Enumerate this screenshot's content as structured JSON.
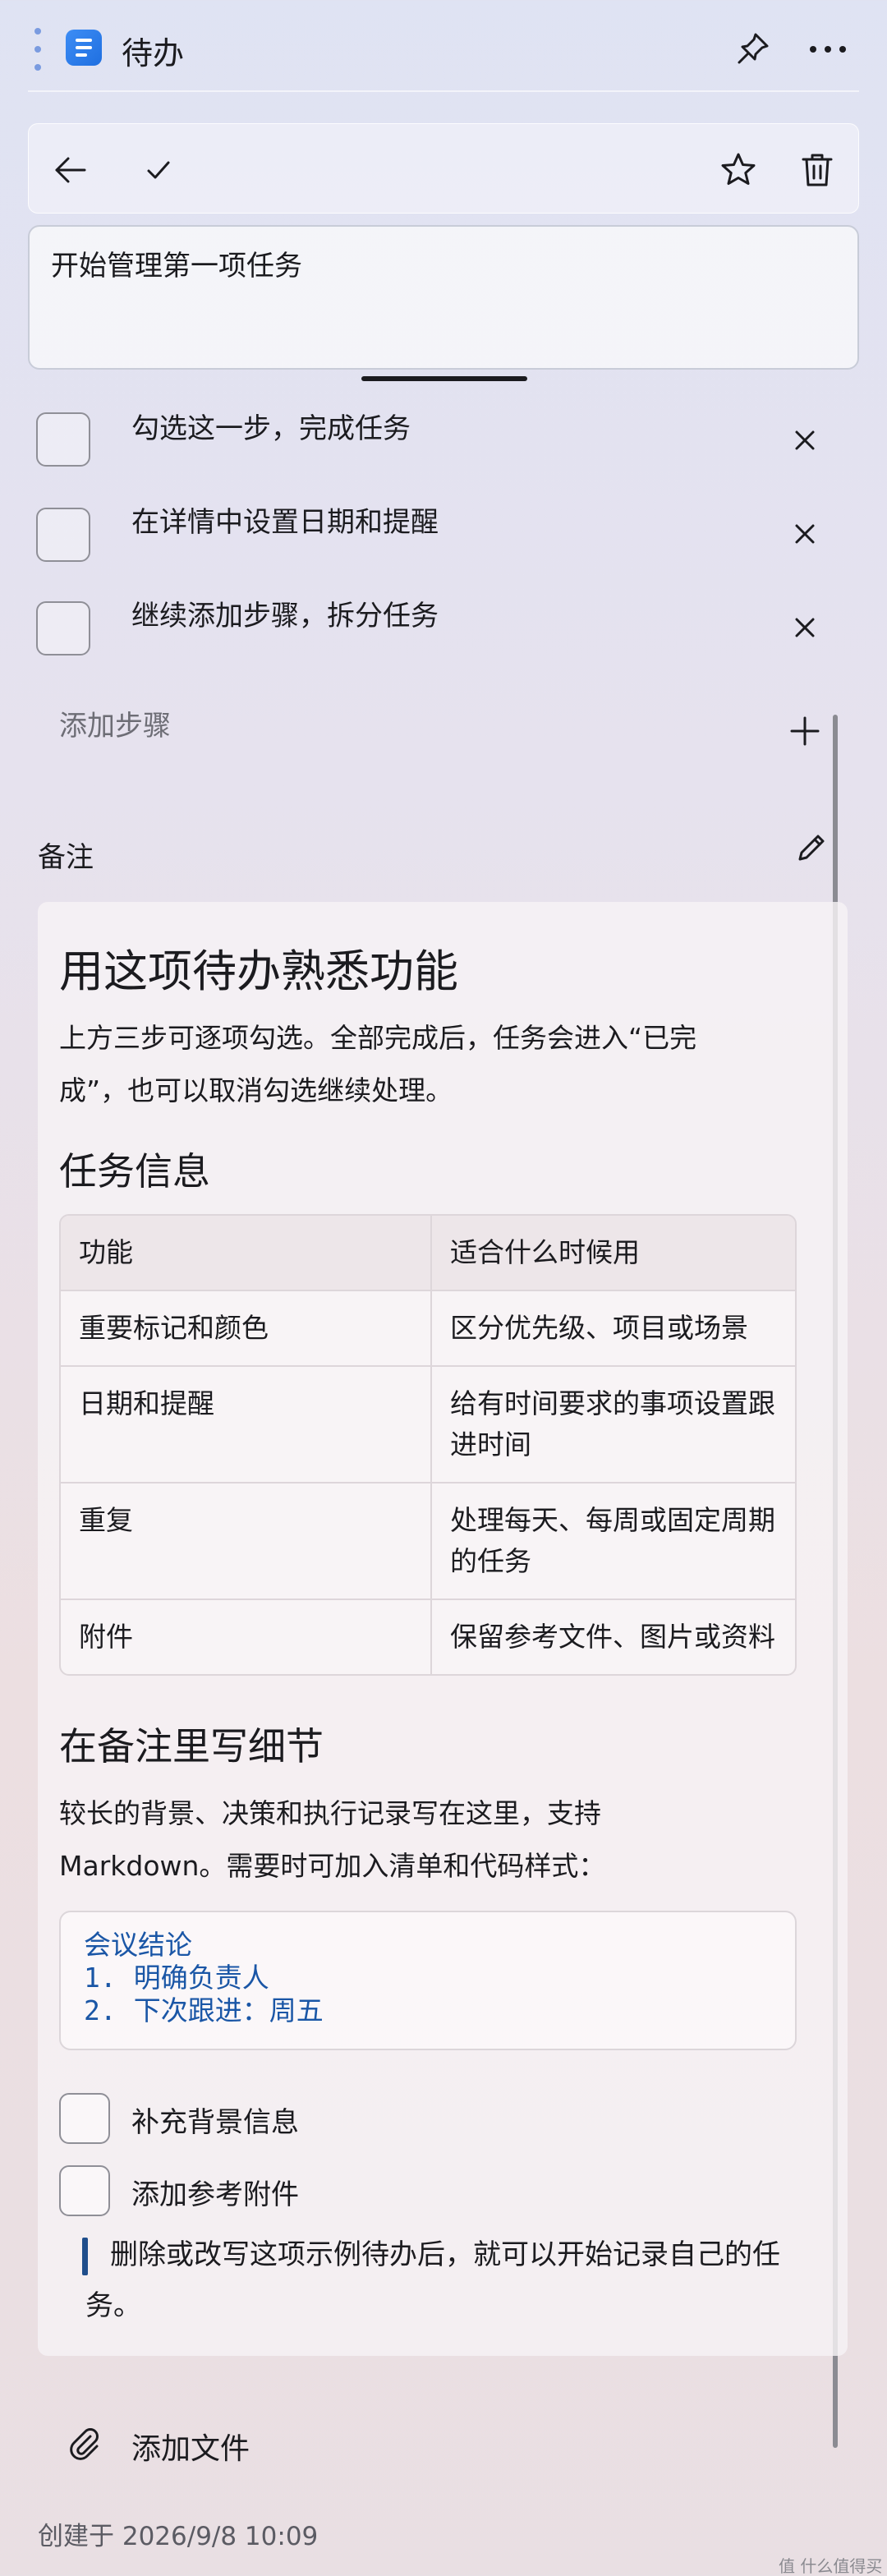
{
  "app": {
    "title": "待办"
  },
  "task": {
    "title": "开始管理第一项任务"
  },
  "steps": [
    {
      "label": "勾选这一步，完成任务"
    },
    {
      "label": "在详情中设置日期和提醒"
    },
    {
      "label": "继续添加步骤，拆分任务"
    }
  ],
  "add_step": {
    "label": "添加步骤"
  },
  "notes": {
    "section_label": "备注",
    "heading": "用这项待办熟悉功能",
    "intro_line1": "上方三步可逐项勾选。全部完成后，任务会进入“已完",
    "intro_line2": "成”，也可以取消勾选继续处理。",
    "subheading1": "任务信息",
    "table": {
      "headers": [
        "功能",
        "适合什么时候用"
      ],
      "rows": [
        [
          "重要标记和颜色",
          "区分优先级、项目或场景"
        ],
        [
          "日期和提醒",
          "给有时间要求的事项设置跟进时间"
        ],
        [
          "重复",
          "处理每天、每周或固定周期的任务"
        ],
        [
          "附件",
          "保留参考文件、图片或资料"
        ]
      ]
    },
    "subheading2": "在备注里写细节",
    "detail_line1": "较长的背景、决策和执行记录写在这里，支持",
    "detail_line2": "Markdown。需要时可加入清单和代码样式：",
    "code": {
      "line1": "会议结论",
      "line2_num": "1.",
      "line2_text": "明确负责人",
      "line3_num": "2.",
      "line3_text": "下次跟进：周五"
    },
    "checklist": [
      {
        "label": "补充背景信息"
      },
      {
        "label": "添加参考附件"
      }
    ],
    "quote": "删除或改写这项示例待办后，就可以开始记录自己的任务。"
  },
  "attach": {
    "label": "添加文件"
  },
  "created": "创建于 2026/9/8 10:09",
  "watermark": "值 什么值得买",
  "icons": {
    "grip": "vertical-dots-icon",
    "app": "todo-list-icon",
    "pin": "pin-icon",
    "more": "more-horizontal-icon",
    "back": "arrow-left-icon",
    "complete": "checkmark-icon",
    "star": "star-icon",
    "delete": "trash-icon",
    "remove": "close-icon",
    "add": "plus-icon",
    "edit": "pencil-icon",
    "attach": "paperclip-icon"
  },
  "colors": {
    "accent": "#1f6fe0",
    "code_text": "#1a56a6",
    "quote_bar": "#1f4e8c"
  }
}
